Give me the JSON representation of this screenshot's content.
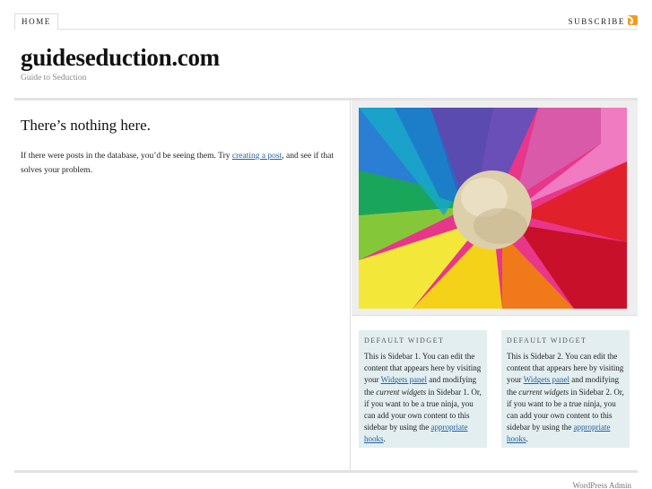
{
  "nav": {
    "home_label": "HOME",
    "subscribe_label": "SUBSCRIBE",
    "rss_icon": "rss-icon"
  },
  "header": {
    "site_title": "guideseduction.com",
    "tagline": "Guide to Seduction"
  },
  "main": {
    "heading": "There’s nothing here.",
    "text_before": "If there were posts in the database, you’d be seeing them. Try ",
    "link_text": "creating a post",
    "text_after": ", and see if that solves your problem."
  },
  "widgets": [
    {
      "title": "Default Widget",
      "text_1": "This is Sidebar 1. You can edit the content that appears here by visiting your ",
      "link_1": "Widgets panel",
      "text_2": " and modifying the ",
      "em": "current widgets",
      "text_3": " in Sidebar 1. Or, if you want to be a true ninja, you can add your own content to this sidebar by using the ",
      "link_2": "appropriate hooks",
      "text_4": "."
    },
    {
      "title": "Default Widget",
      "text_1": "This is Sidebar 2. You can edit the content that appears here by visiting your ",
      "link_1": "Widgets panel",
      "text_2": " and modifying the ",
      "em": "current widgets",
      "text_3": " in Sidebar 2. Or, if you want to be a true ninja, you can add your own content to this sidebar by using the ",
      "link_2": "appropriate hooks",
      "text_4": "."
    }
  ],
  "footer": {
    "admin_link": "WordPress Admin"
  },
  "colors": {
    "link": "#2361a1",
    "widget_bg": "#e3eef0",
    "rss": "#f39a1e"
  }
}
